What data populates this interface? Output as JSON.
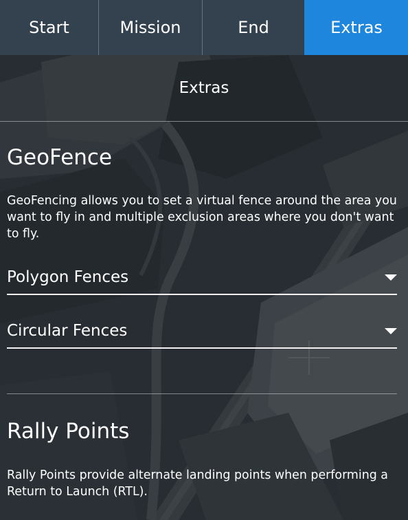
{
  "tabs": [
    {
      "label": "Start",
      "active": false
    },
    {
      "label": "Mission",
      "active": false
    },
    {
      "label": "End",
      "active": false
    },
    {
      "label": "Extras",
      "active": true
    }
  ],
  "header": {
    "title": "Extras"
  },
  "geofence": {
    "title": "GeoFence",
    "description": "GeoFencing allows you to set a virtual fence around the area you want to fly in and multiple exclusion areas where you don't want to fly.",
    "dropdowns": [
      {
        "label": "Polygon Fences",
        "icon": "chevron-down-icon"
      },
      {
        "label": "Circular Fences",
        "icon": "chevron-down-icon"
      }
    ]
  },
  "rally_points": {
    "title": "Rally Points",
    "description": "Rally Points provide alternate landing points when performing a Return to Launch (RTL)."
  },
  "colors": {
    "tab_bg": "#34414f",
    "tab_active": "#1f86dd",
    "text": "#ffffff"
  }
}
